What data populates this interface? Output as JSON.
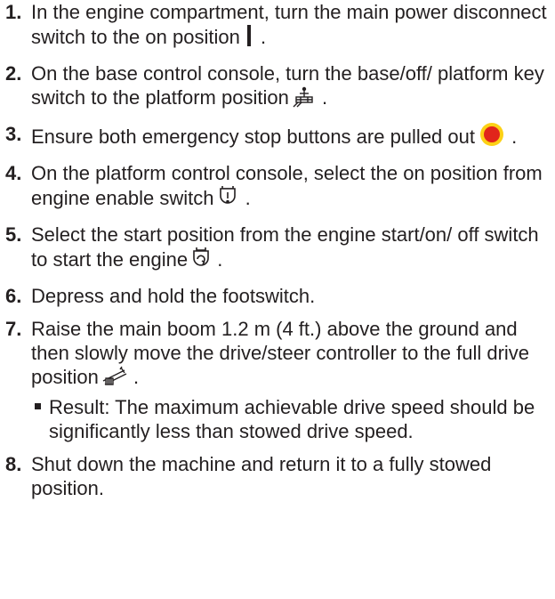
{
  "steps": [
    {
      "number": "1.",
      "text": "In the engine compartment, turn the main power disconnect switch to the on position",
      "icon": "on-position-bar-icon",
      "suffix": "."
    },
    {
      "number": "2.",
      "text": "On the base control console, turn the base/off/ platform key switch to the platform position",
      "icon": "platform-icon",
      "suffix": "."
    },
    {
      "number": "3.",
      "text": "Ensure both emergency stop buttons are pulled out",
      "icon": "emergency-stop-icon",
      "suffix": ".",
      "colors": {
        "button_red": "#e1251b",
        "button_ring": "#fcd116"
      }
    },
    {
      "number": "4.",
      "text": "On the platform control console, select the on position from engine enable switch",
      "icon": "engine-enable-icon",
      "suffix": "."
    },
    {
      "number": "5.",
      "text": "Select the start position from the engine start/on/ off switch to start the engine",
      "icon": "engine-start-icon",
      "suffix": "."
    },
    {
      "number": "6.",
      "text": "Depress and hold the footswitch."
    },
    {
      "number": "7.",
      "text": "Raise the main boom 1.2 m (4 ft.) above the ground and then slowly move the drive/steer controller to the full drive position",
      "icon": "drive-position-icon",
      "suffix": ".",
      "result": "Result: The maximum achievable drive speed should be significantly less than stowed drive speed."
    },
    {
      "number": "8.",
      "text": "Shut down the machine and return it to a fully stowed position."
    }
  ]
}
